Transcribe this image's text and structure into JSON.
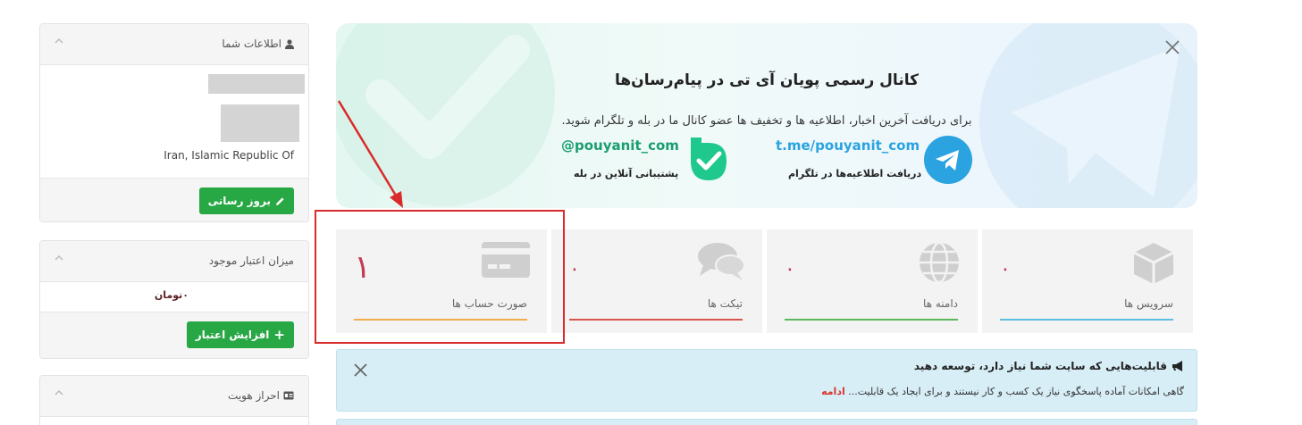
{
  "sidebar": {
    "user_info": {
      "title": "اطلاعات شما",
      "country": "Iran, Islamic Republic Of",
      "update_button": "بروز رسانی"
    },
    "credit": {
      "title": "میزان اعتبار موجود",
      "amount": "۰تومان",
      "add_button": "افزایش اعتبار"
    },
    "identity": {
      "title": "احراز هویت"
    }
  },
  "banner": {
    "title": "کانال رسمی پویان آی تی در پیام‌رسان‌ها",
    "subtitle": "برای دریافت آخرین اخبار، اطلاعیه ها و تخفیف ها عضو کانال ما در بله و تلگرام شوید.",
    "telegram_link": "t.me/pouyanit_com",
    "telegram_caption": "دریافت اطلاعیه‌ها در تلگرام",
    "bale_link": "@pouyanit_com",
    "bale_caption": "پشتیبانی آنلاین در بله",
    "colors": {
      "telegram": "#2aa3e0",
      "bale": "#1fc98e",
      "bale_text": "#1a9e6f"
    }
  },
  "stats": [
    {
      "label": "سرویس ها",
      "value": "۰",
      "icon": "box-icon",
      "color": "#5bc0de"
    },
    {
      "label": "دامنه ها",
      "value": "۰",
      "icon": "globe-icon",
      "color": "#5cb85c"
    },
    {
      "label": "تیکت ها",
      "value": "۰",
      "icon": "comments-icon",
      "color": "#d9534f"
    },
    {
      "label": "صورت حساب ها",
      "value": "۱",
      "icon": "credit-card-icon",
      "color": "#f0ad4e"
    }
  ],
  "alert": {
    "title": "قابلیت‌هایی که سایت شما نیاز دارد، توسعه دهید",
    "body": "گاهی امکانات آماده پاسخگوی نیاز یک کسب و کار نیستند و برای ایجاد یک قابلیت... ",
    "more": "ادامه"
  },
  "annotation": {
    "color": "#d92b2b"
  }
}
